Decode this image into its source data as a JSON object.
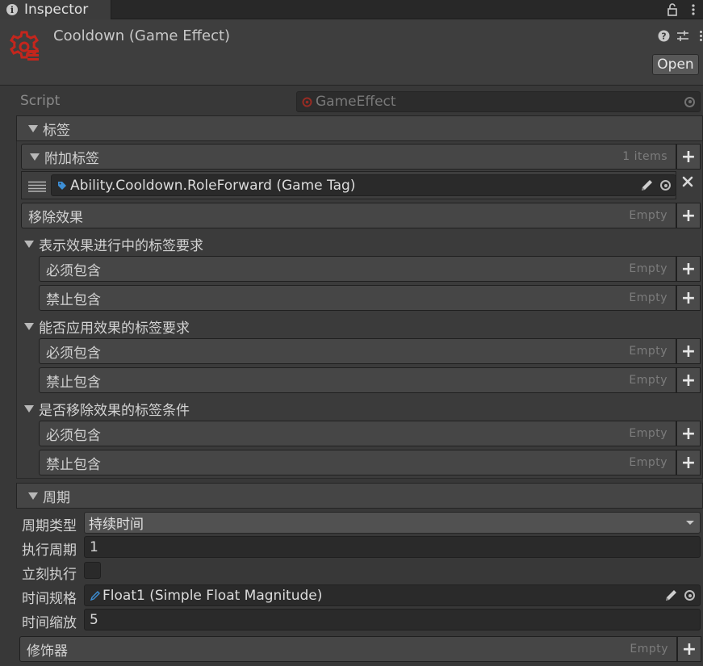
{
  "tab": {
    "title": "Inspector"
  },
  "header": {
    "title": "Cooldown (Game Effect)",
    "open_label": "Open"
  },
  "script_field": {
    "label": "Script",
    "value": "GameEffect"
  },
  "tags_section": {
    "title": "标签",
    "added_tags": {
      "label": "附加标签",
      "count": "1 items",
      "items": [
        "Ability.Cooldown.RoleForward (Game Tag)"
      ]
    },
    "remove_effects": {
      "label": "移除效果",
      "status": "Empty"
    },
    "ongoing_req": {
      "title": "表示效果进行中的标签要求",
      "must_include": {
        "label": "必须包含",
        "status": "Empty"
      },
      "must_exclude": {
        "label": "禁止包含",
        "status": "Empty"
      }
    },
    "apply_req": {
      "title": "能否应用效果的标签要求",
      "must_include": {
        "label": "必须包含",
        "status": "Empty"
      },
      "must_exclude": {
        "label": "禁止包含",
        "status": "Empty"
      }
    },
    "remove_cond": {
      "title": "是否移除效果的标签条件",
      "must_include": {
        "label": "必须包含",
        "status": "Empty"
      },
      "must_exclude": {
        "label": "禁止包含",
        "status": "Empty"
      }
    }
  },
  "period_section": {
    "title": "周期",
    "period_type": {
      "label": "周期类型",
      "value": "持续时间"
    },
    "exec_period": {
      "label": "执行周期",
      "value": "1"
    },
    "exec_immediately": {
      "label": "立刻执行",
      "checked": false
    },
    "time_spec": {
      "label": "时间规格",
      "value": "Float1 (Simple Float Magnitude)"
    },
    "time_scale": {
      "label": "时间缩放",
      "value": "5"
    }
  },
  "modifiers": {
    "label": "修饰器",
    "status": "Empty"
  },
  "colors": {
    "icon_red": "#c4261d",
    "tag_blue": "#3d8fd6",
    "background": "#383838"
  }
}
